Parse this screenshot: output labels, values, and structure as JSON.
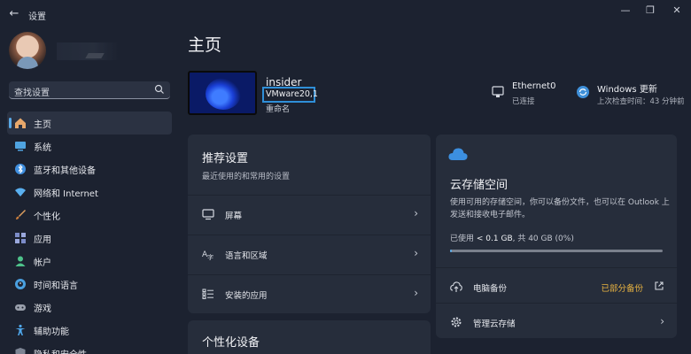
{
  "window": {
    "title": "设置",
    "controls": [
      "—",
      "❐",
      "✕"
    ]
  },
  "search": {
    "placeholder": "查找设置"
  },
  "sidebar": {
    "items": [
      {
        "label": "主页",
        "icon": "home-icon",
        "color": "#e8a86b"
      },
      {
        "label": "系统",
        "icon": "system-icon",
        "color": "#4fa3e0"
      },
      {
        "label": "蓝牙和其他设备",
        "icon": "bluetooth-icon",
        "color": "#3f8fe0"
      },
      {
        "label": "网络和 Internet",
        "icon": "wifi-icon",
        "color": "#5ab0f0"
      },
      {
        "label": "个性化",
        "icon": "brush-icon",
        "color": "#e0a060"
      },
      {
        "label": "应用",
        "icon": "apps-icon",
        "color": "#7c8cc8"
      },
      {
        "label": "帐户",
        "icon": "account-icon",
        "color": "#4ec28a"
      },
      {
        "label": "时间和语言",
        "icon": "globe-clock-icon",
        "color": "#4aa0e0"
      },
      {
        "label": "游戏",
        "icon": "gamepad-icon",
        "color": "#9aa0ac"
      },
      {
        "label": "辅助功能",
        "icon": "accessibility-icon",
        "color": "#4fa8ec"
      },
      {
        "label": "隐私和安全性",
        "icon": "shield-icon",
        "color": "#7d8594"
      }
    ]
  },
  "main": {
    "title": "主页",
    "device": {
      "name": "insider",
      "model": "VMware20,1",
      "rename": "重命名"
    },
    "status": [
      {
        "title": "Ethernet0",
        "sub": "已连接",
        "icon": "ethernet-icon"
      },
      {
        "title": "Windows 更新",
        "sub": "上次检查时间：43 分钟前",
        "icon": "update-icon"
      }
    ],
    "recommended": {
      "title": "推荐设置",
      "subtitle": "最近使用的和常用的设置",
      "rows": [
        {
          "label": "屏幕",
          "icon": "monitor-icon"
        },
        {
          "label": "语言和区域",
          "icon": "language-icon"
        },
        {
          "label": "安装的应用",
          "icon": "app-list-icon"
        }
      ]
    },
    "personalize": {
      "title": "个性化设备"
    },
    "cloud": {
      "title": "云存储空间",
      "description": "使用可用的存储空间，你可以备份文件，也可以在 Outlook 上发送和接收电子邮件。",
      "usage_prefix": "已使用",
      "usage_value": "< 0.1 GB",
      "usage_suffix": ", 共 40 GB (0%)",
      "usage_fraction": 0.005,
      "rows": [
        {
          "label": "电脑备份",
          "status": "已部分备份",
          "icon": "cloud-upload-icon"
        },
        {
          "label": "管理云存储",
          "icon": "gear-icon"
        }
      ],
      "accent": "#5aa9e6",
      "warning": "#e8b341"
    }
  }
}
